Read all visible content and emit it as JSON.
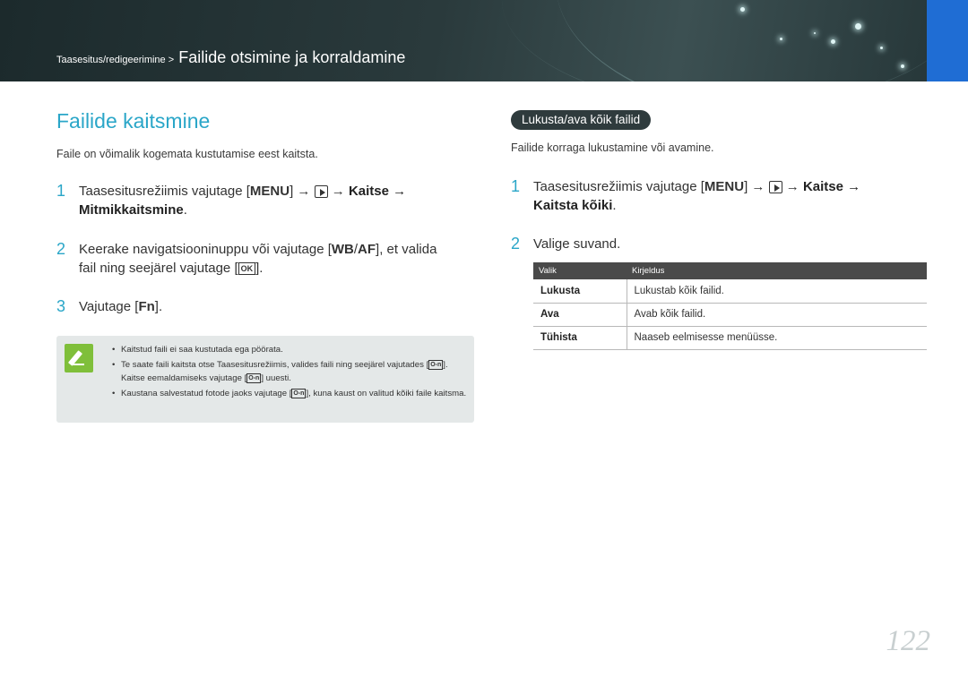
{
  "header": {
    "breadcrumb_parent": "Taasesitus/redigeerimine >",
    "breadcrumb_current": "Failide otsimine ja korraldamine"
  },
  "left": {
    "title": "Failide kaitsmine",
    "intro": "Faile on võimalik kogemata kustutamise eest kaitsta.",
    "steps": [
      {
        "num": "1",
        "text_a": "Taasesitusrežiimis vajutage [",
        "key_menu": "MENU",
        "text_b": "] →",
        "text_c": "→",
        "bold_1": "Kaitse",
        "text_d": "→",
        "bold_2": "Mitmikkaitsmine",
        "text_e": "."
      },
      {
        "num": "2",
        "text_a": "Keerake navigatsiooninuppu või vajutage [",
        "key_wb": "WB",
        "sep": "/",
        "key_af": "AF",
        "text_b": "], et valida",
        "text_c": "fail ning seejärel vajutage [",
        "key_ok": "OK",
        "text_d": "]."
      },
      {
        "num": "3",
        "text_a": "Vajutage [",
        "key_fn": "Fn",
        "text_b": "]."
      }
    ],
    "notes": [
      {
        "text": "Kaitstud faili ei saa kustutada ega pöörata."
      },
      {
        "text_a": "Te saate faili kaitsta otse Taasesitusrežiimis, valides faili ning seejärel vajutades [",
        "key": "O-n",
        "text_b": "]. Kaitse eemaldamiseks vajutage [",
        "text_c": "] uuesti."
      },
      {
        "text_a": "Kaustana salvestatud fotode jaoks vajutage [",
        "key": "O-n",
        "text_b": "], kuna kaust on valitud kõiki faile kaitsma."
      }
    ]
  },
  "right": {
    "section_label": "Lukusta/ava kõik failid",
    "intro": "Failide korraga lukustamine või avamine.",
    "steps": [
      {
        "num": "1",
        "text_a": "Taasesitusrežiimis vajutage [",
        "key_menu": "MENU",
        "text_b": "] →",
        "text_c": "→",
        "bold_1": "Kaitse",
        "text_d": "→",
        "bold_2": "Kaitsta kõiki",
        "text_e": "."
      },
      {
        "num": "2",
        "text_a": "Valige suvand."
      }
    ],
    "table": {
      "headers": [
        "Valik",
        "Kirjeldus"
      ],
      "rows": [
        [
          "Lukusta",
          "Lukustab kõik failid."
        ],
        [
          "Ava",
          "Avab kõik failid."
        ],
        [
          "Tühista",
          "Naaseb eelmisesse menüüsse."
        ]
      ]
    }
  },
  "page_number": "122",
  "colors": {
    "accent": "#2aa6c8",
    "blue_tab": "#1f6dd4",
    "note_icon": "#7fbf3a"
  }
}
